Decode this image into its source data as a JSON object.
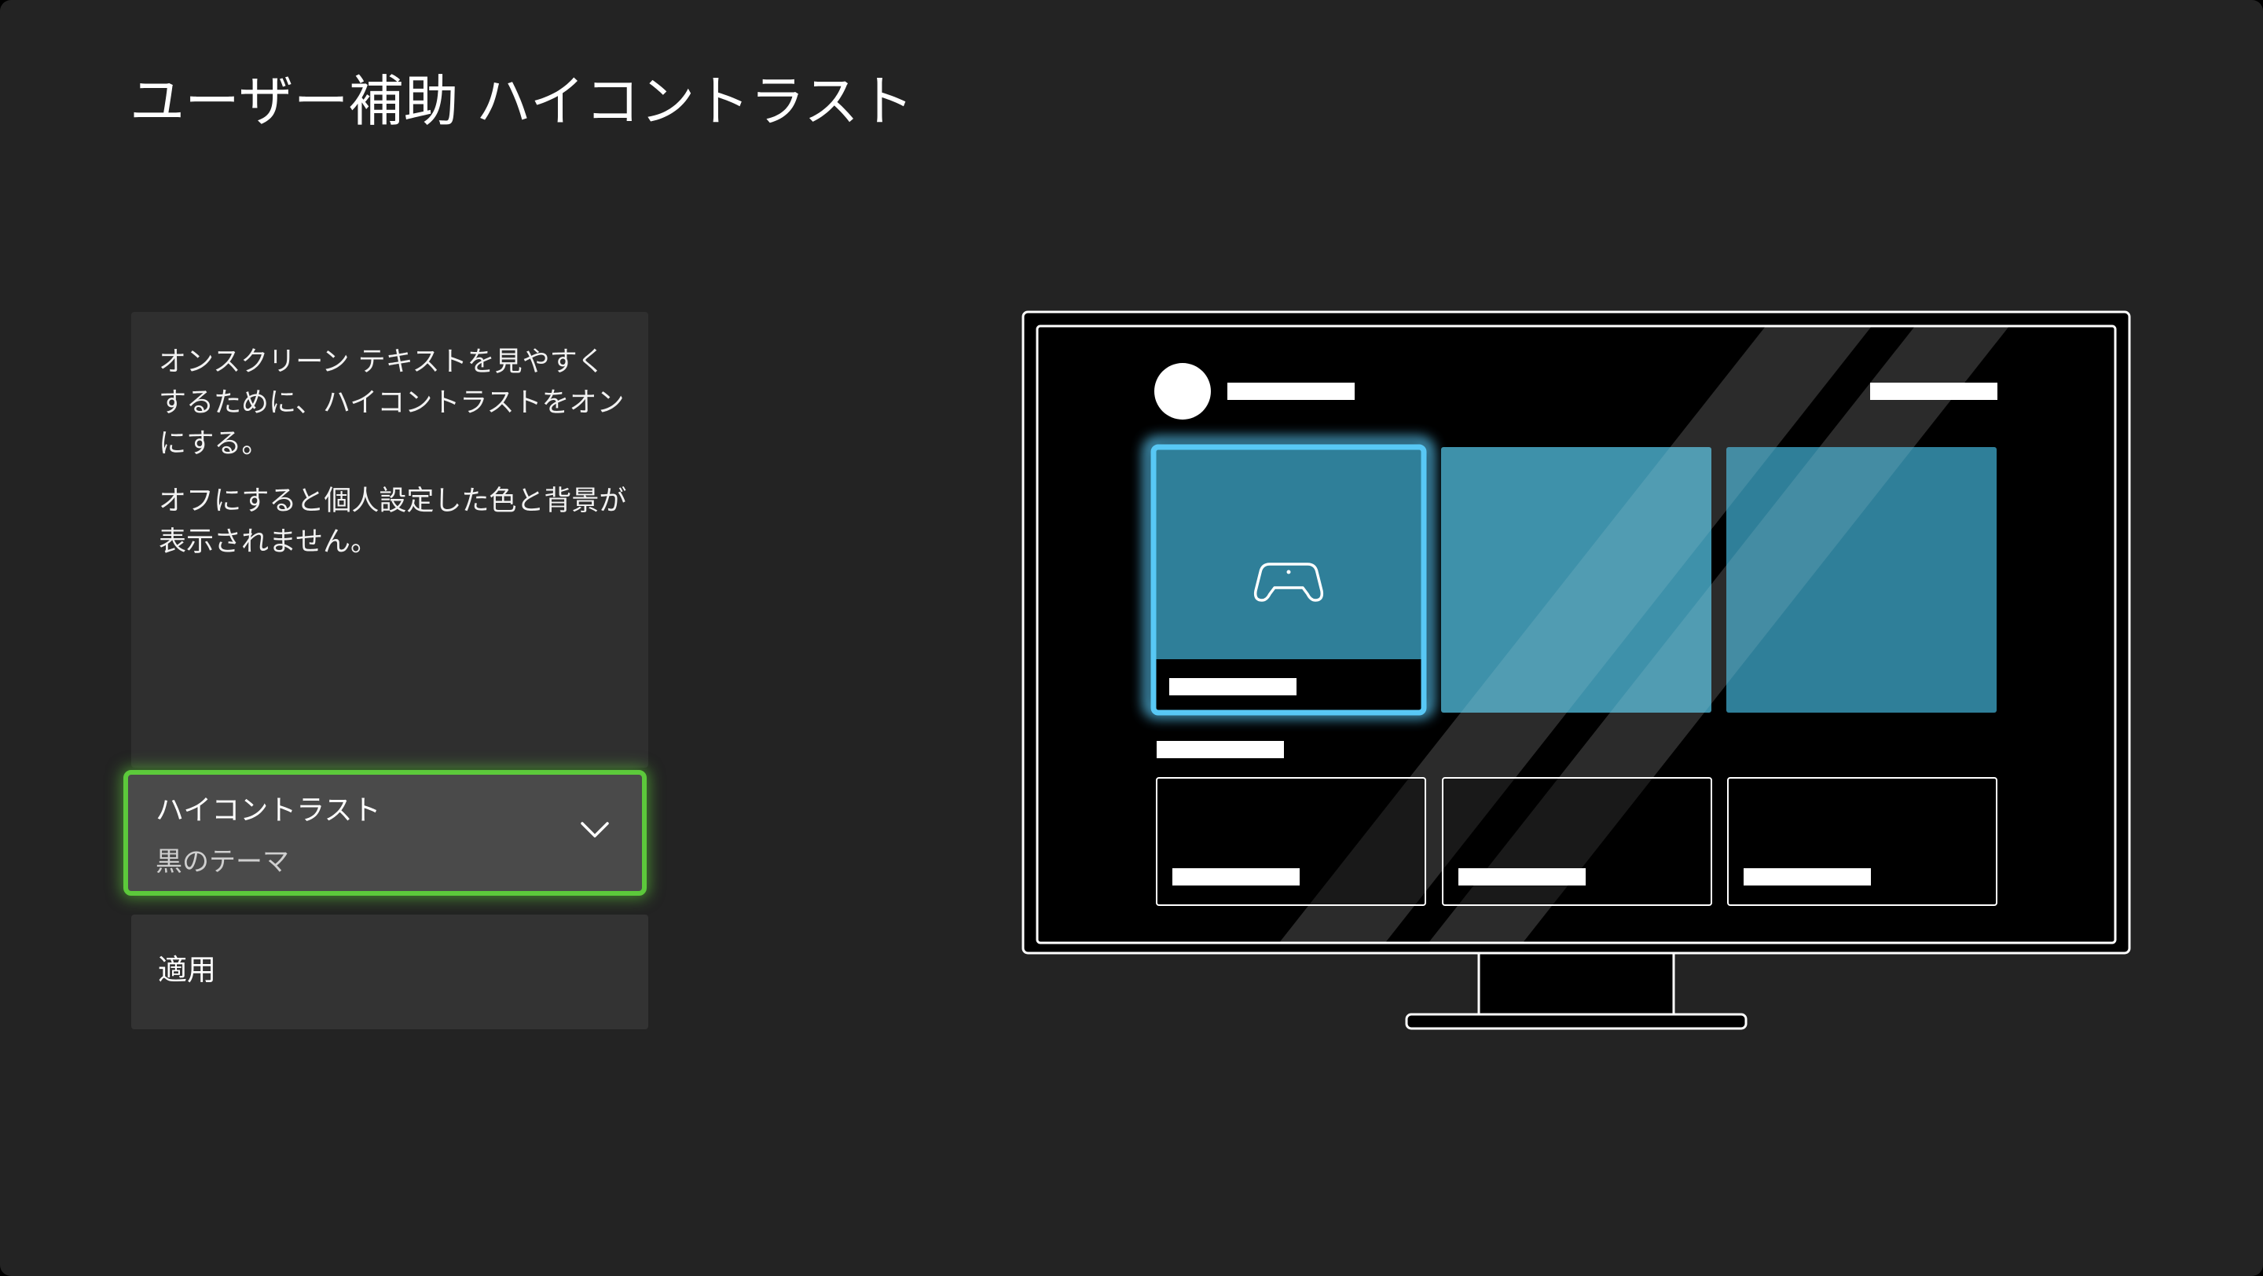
{
  "page": {
    "title": "ユーザー補助 ハイコントラスト"
  },
  "description": {
    "paragraph1": "オンスクリーン テキストを見やすくするために、ハイコントラストをオンにする。",
    "paragraph2": "オフにすると個人設定した色と背景が表示されません。"
  },
  "high_contrast_select": {
    "label": "ハイコントラスト",
    "selected_value": "黒のテーマ",
    "focus_color": "#5cc93b"
  },
  "apply_button": {
    "label": "適用"
  },
  "preview": {
    "highlight_color": "#58c8f5",
    "tile_color": "#2f7f99",
    "icons": [
      "controller-icon",
      "chevron-down-icon"
    ]
  }
}
